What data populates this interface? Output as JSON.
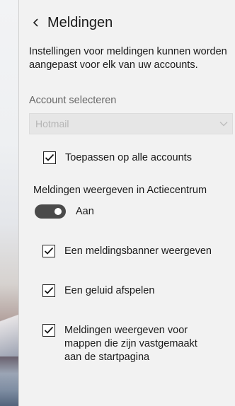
{
  "header": {
    "title": "Meldingen",
    "back_icon": "chevron-left-icon"
  },
  "description": "Instellingen voor meldingen kunnen worden aangepast voor elk van uw accounts.",
  "account": {
    "label": "Account selecteren",
    "selected": "Hotmail",
    "dropdown_icon": "chevron-down-icon"
  },
  "apply_all": {
    "label": "Toepassen op alle accounts",
    "checked": true
  },
  "action_center": {
    "title": "Meldingen weergeven in Actiecentrum",
    "toggle_state": "Aan",
    "on": true
  },
  "options": [
    {
      "label": "Een meldingsbanner weergeven",
      "checked": true
    },
    {
      "label": "Een geluid afspelen",
      "checked": true
    },
    {
      "label": "Meldingen weergeven voor mappen die zijn vastgemaakt aan de startpagina",
      "checked": true
    }
  ],
  "colors": {
    "panel_bg": "#f2f2f2",
    "toggle_on": "#4a4a4a",
    "text": "#1a1a1a",
    "muted": "#666666"
  }
}
